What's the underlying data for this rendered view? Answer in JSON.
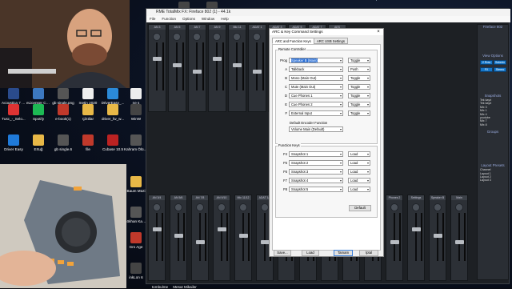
{
  "desktop": {
    "icons": [
      {
        "label": "Acoustica 7 - 64 Bit",
        "icon": "waveform-icon",
        "color": "#2a4b8c"
      },
      {
        "label": "eLicenser Control...",
        "icon": "license-icon",
        "color": "#3c78c0"
      },
      {
        "label": "gb single.png",
        "icon": "image-icon",
        "color": "#555"
      },
      {
        "label": "metin 2020",
        "icon": "document-icon",
        "color": "#eee"
      },
      {
        "label": "DriverEasy_...",
        "icon": "setup-icon",
        "color": "#2b8ad8"
      },
      {
        "label": "ne s",
        "icon": "document-icon",
        "color": "#eee"
      },
      {
        "label": "Tusc_-_Selo...",
        "icon": "music-icon",
        "color": "#d33"
      },
      {
        "label": "Spotify",
        "icon": "spotify-icon",
        "color": "#1db954"
      },
      {
        "label": "e-book(1)",
        "icon": "pdf-icon",
        "color": "#c0392b"
      },
      {
        "label": "Çiktilar",
        "icon": "folder-icon",
        "color": "#e8b847"
      },
      {
        "label": "driver_fw_w...",
        "icon": "folder-icon",
        "color": "#e8b847"
      },
      {
        "label": "WinW",
        "icon": "app-icon",
        "color": "#444"
      },
      {
        "label": "Driver Easy",
        "icon": "drivereasy-icon",
        "color": "#1f7ad9"
      },
      {
        "label": "Ertuğ",
        "icon": "folder-icon",
        "color": "#e8b847"
      },
      {
        "label": "gb single.6",
        "icon": "image-icon",
        "color": "#555"
      },
      {
        "label": "file",
        "icon": "pdf-icon",
        "color": "#c0392b"
      },
      {
        "label": "Cubase 10.5",
        "icon": "cubase-icon",
        "color": "#b22"
      },
      {
        "label": "Kahram Ölüms",
        "icon": "image-icon",
        "color": "#555"
      },
      {
        "label": "Baum Müzi",
        "icon": "folder-icon",
        "color": "#e8b847"
      },
      {
        "label": "Gökhan Kahram",
        "icon": "image-icon",
        "color": "#555"
      },
      {
        "label": "Gro Age",
        "icon": "pdf-icon",
        "color": "#c0392b"
      },
      {
        "label": "inkLon 6",
        "icon": "app-icon",
        "color": "#444"
      },
      {
        "label": "tombulme",
        "icon": "app-icon",
        "color": "#444"
      },
      {
        "label": "Mesut Mikailer",
        "icon": "app-icon",
        "color": "#444"
      },
      {
        "label": "O wav Kayıt",
        "icon": "audio-icon",
        "color": "#444"
      },
      {
        "label": "DID",
        "icon": "app-icon",
        "color": "#444"
      }
    ]
  },
  "mixer": {
    "title": "RME TotalMix FX: Fireface 802 (1) - 44.1k",
    "menu": [
      "File",
      "Function",
      "Options",
      "Window",
      "Help"
    ],
    "top_strip_labels": [
      "AN 3",
      "AN 5",
      "AN 7",
      "AN 9",
      "Mic 11",
      "ADAT 1",
      "ADAT 3",
      "ADAT 5",
      "ADAT 7",
      "AES"
    ],
    "bottom_strip_labels": [
      "AN 3/4",
      "AN 5/6",
      "AN 7/8",
      "AN 9/10",
      "Mic 11/12",
      "ADAT 1/2",
      "ADAT 3/4",
      "ADAT 5/6",
      "ADAT 7/8",
      "ADAT 9/10",
      "AES",
      "Phones 2",
      "Settings",
      "Speaker B",
      "Main"
    ],
    "right_panel": {
      "device": "Fireface 802",
      "view_options_title": "View Options",
      "view_buttons": [
        "2 Row",
        "Submix",
        "FX",
        "Stereo"
      ],
      "snapshots_title": "Snapshots",
      "snapshots": [
        "Tek kayıt",
        "Tek kayıt",
        "Mix 3",
        "Mix 1",
        "Mix 4",
        "youtube",
        "Mix 7",
        "Mix 8"
      ],
      "groups_title": "Groups",
      "layout_presets_title": "Layout Presets",
      "layout_presets": [
        "Channel",
        "Layout 1",
        "Layout 2",
        "Layout 3"
      ]
    }
  },
  "dialog": {
    "title": "ARC & Key Command Settings",
    "tabs": [
      "ARC and Function Keys",
      "ARC USB Settings"
    ],
    "remote_group": "Remote Controller",
    "rows": [
      {
        "key": "Prog",
        "value": "Speaker B (Main)",
        "mode": "Toggle",
        "selected": true
      },
      {
        "key": "A",
        "value": "Talkback",
        "mode": "Push",
        "selected": false
      },
      {
        "key": "B",
        "value": "Mono (Main Out)",
        "mode": "Toggle",
        "selected": false
      },
      {
        "key": "C",
        "value": "Mute (Main Out)",
        "mode": "Toggle",
        "selected": false
      },
      {
        "key": "D",
        "value": "Cue Phones 1",
        "mode": "Toggle",
        "selected": false
      },
      {
        "key": "E",
        "value": "Cue Phones 2",
        "mode": "Toggle",
        "selected": false
      },
      {
        "key": "F",
        "value": "External Input",
        "mode": "Toggle",
        "selected": false
      }
    ],
    "encoder_label": "Default Encoder Function",
    "encoder_value": "Volume Main (Default)",
    "function_keys_group": "Function Keys",
    "fkeys": [
      {
        "key": "F4",
        "value": "Snapshot 1",
        "action": "Load"
      },
      {
        "key": "F5",
        "value": "Snapshot 2",
        "action": "Load"
      },
      {
        "key": "F6",
        "value": "Snapshot 3",
        "action": "Load"
      },
      {
        "key": "F7",
        "value": "Snapshot 4",
        "action": "Load"
      },
      {
        "key": "F8",
        "value": "Snapshot 5",
        "action": "Load"
      }
    ],
    "default_button": "Default",
    "footer_buttons": [
      "Save...",
      "Load",
      "Tamam",
      "İptal"
    ],
    "close_glyph": "×"
  }
}
